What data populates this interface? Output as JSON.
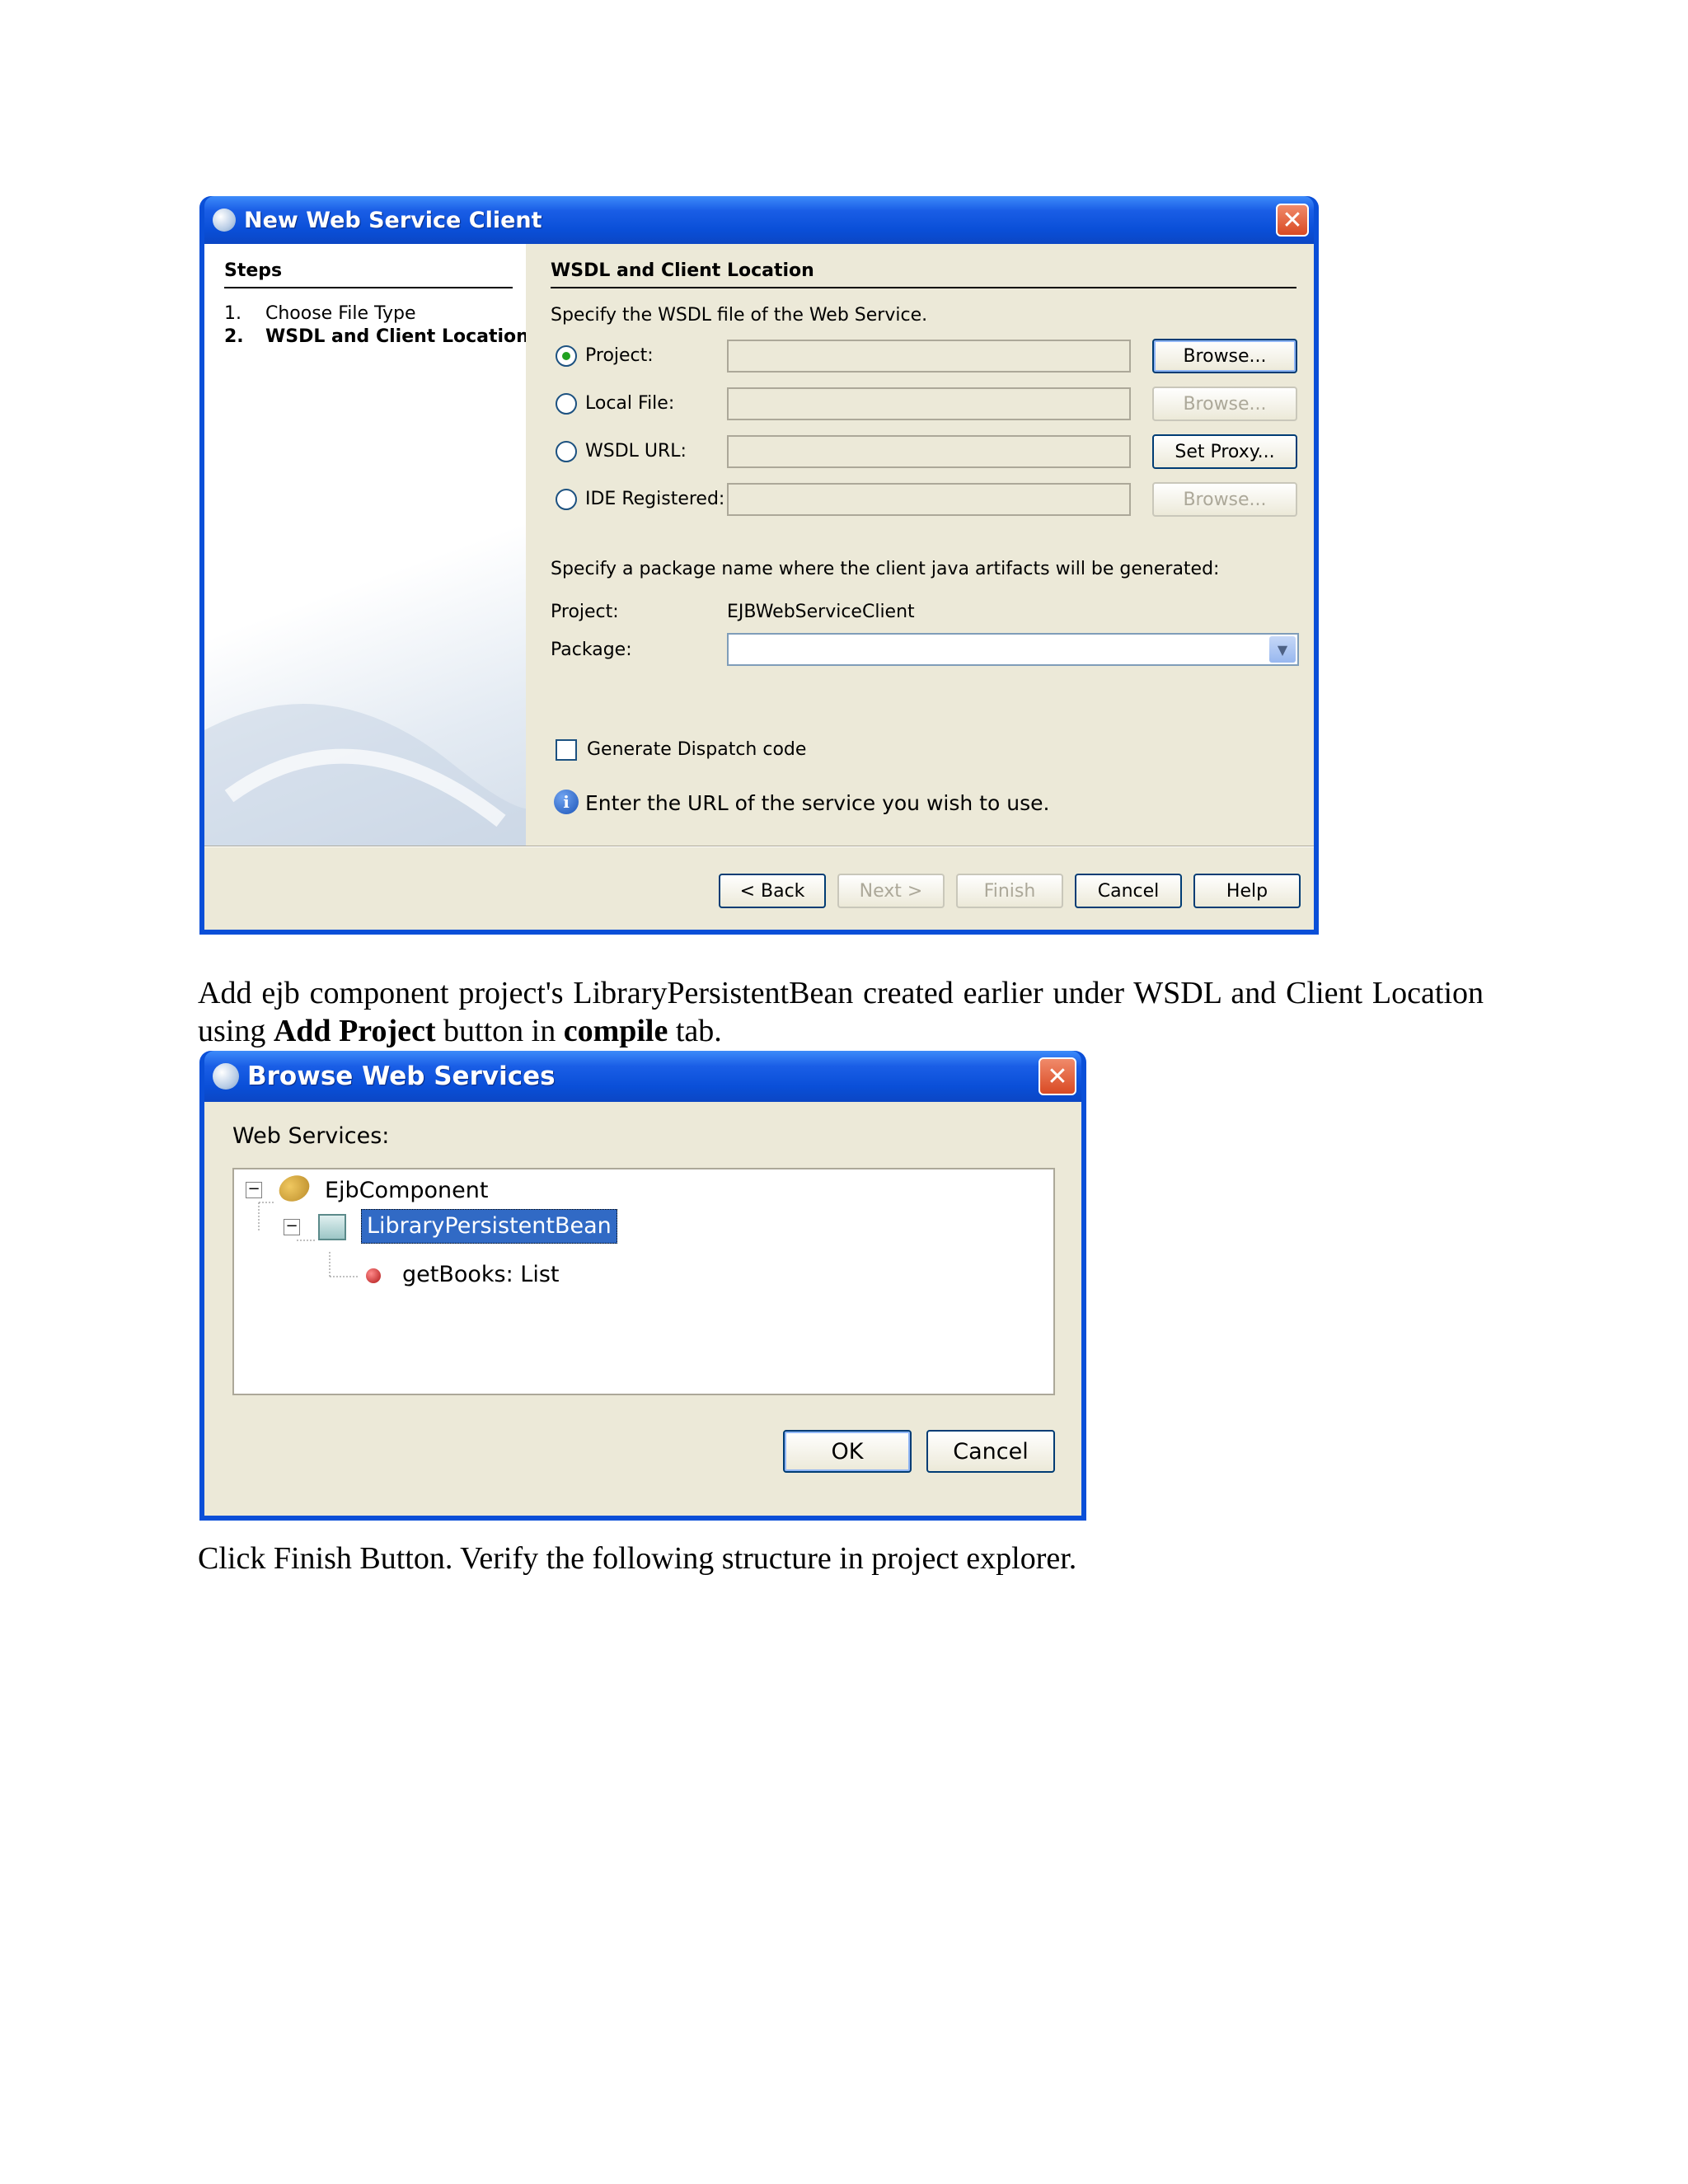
{
  "dialog1": {
    "title": "New Web Service Client",
    "steps_header": "Steps",
    "steps": [
      {
        "num": "1.",
        "label": "Choose File Type"
      },
      {
        "num": "2.",
        "label": "WSDL and Client Location"
      }
    ],
    "section_title": "WSDL and Client Location",
    "instruction": "Specify the WSDL file of the Web Service.",
    "options": [
      {
        "label": "Project:",
        "button": "Browse...",
        "selected": true
      },
      {
        "label": "Local File:",
        "button": "Browse...",
        "selected": false
      },
      {
        "label": "WSDL URL:",
        "button": "Set Proxy...",
        "selected": false
      },
      {
        "label": "IDE Registered:",
        "button": "Browse...",
        "selected": false
      }
    ],
    "package_instruction": "Specify a package name where the client java artifacts will be generated:",
    "project_label": "Project:",
    "project_value": "EJBWebServiceClient",
    "package_label": "Package:",
    "dispatch_label": "Generate Dispatch code",
    "info_message": "Enter the URL of the service you wish to use.",
    "buttons": {
      "back": "< Back",
      "next": "Next >",
      "finish": "Finish",
      "cancel": "Cancel",
      "help": "Help"
    }
  },
  "paragraph1": {
    "text_a": "Add ejb component project's LibraryPersistentBean created earlier under WSDL and Client Location using ",
    "bold_a": "Add Project",
    "text_b": " button in ",
    "bold_b": "compile",
    "text_c": " tab."
  },
  "dialog2": {
    "title": "Browse Web Services",
    "label": "Web Services:",
    "tree": {
      "root": "EjbComponent",
      "child": "LibraryPersistentBean",
      "leaf": "getBooks: List"
    },
    "buttons": {
      "ok": "OK",
      "cancel": "Cancel"
    }
  },
  "paragraph2": "Click Finish Button. Verify the following structure in project explorer.",
  "colors": {
    "title_blue": "#0a4fd8",
    "dialog_bg": "#ece9d8",
    "selection": "#316ac5"
  }
}
